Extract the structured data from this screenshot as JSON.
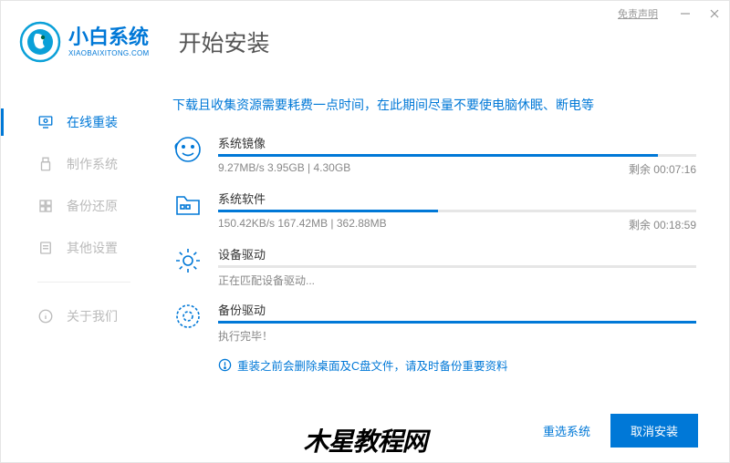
{
  "titlebar": {
    "disclaimer": "免责声明"
  },
  "brand": {
    "title": "小白系统",
    "subtitle": "XIAOBAIXITONG.COM"
  },
  "page_title": "开始安装",
  "sidebar": {
    "items": [
      {
        "label": "在线重装"
      },
      {
        "label": "制作系统"
      },
      {
        "label": "备份还原"
      },
      {
        "label": "其他设置"
      },
      {
        "label": "关于我们"
      }
    ]
  },
  "notice": "下载且收集资源需要耗费一点时间，在此期间尽量不要使电脑休眠、断电等",
  "tasks": [
    {
      "title": "系统镜像",
      "status_left": "9.27MB/s 3.95GB | 4.30GB",
      "status_right": "剩余 00:07:16",
      "progress": 92
    },
    {
      "title": "系统软件",
      "status_left": "150.42KB/s 167.42MB | 362.88MB",
      "status_right": "剩余 00:18:59",
      "progress": 46
    },
    {
      "title": "设备驱动",
      "status_left": "正在匹配设备驱动...",
      "status_right": "",
      "progress": 0
    },
    {
      "title": "备份驱动",
      "status_left": "执行完毕！",
      "status_right": "",
      "progress": 100
    }
  ],
  "warning": "重装之前会删除桌面及C盘文件，请及时备份重要资料",
  "footer": {
    "reselect": "重选系统",
    "cancel": "取消安装"
  },
  "watermark": "木星教程网"
}
